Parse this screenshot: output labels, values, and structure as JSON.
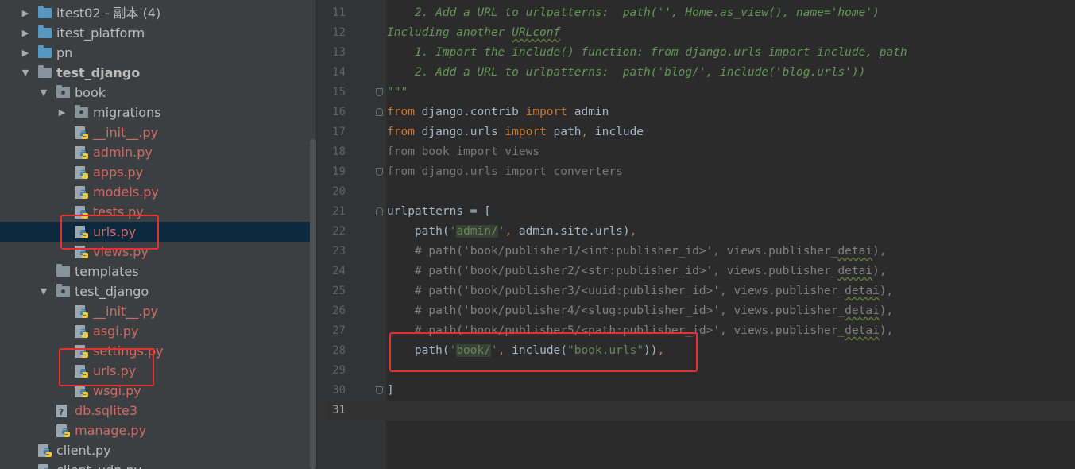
{
  "tree": {
    "rows": [
      {
        "id": "itest02",
        "label": "itest02 - 副本 (4)",
        "type": "folder",
        "expanded": false
      },
      {
        "id": "itest_platform",
        "label": "itest_platform",
        "type": "folder",
        "expanded": false
      },
      {
        "id": "pn",
        "label": "pn",
        "type": "folder",
        "expanded": false
      },
      {
        "id": "test_django_root",
        "label": "test_django",
        "type": "folder",
        "expanded": true
      },
      {
        "id": "book",
        "label": "book",
        "type": "package",
        "expanded": true
      },
      {
        "id": "migrations",
        "label": "migrations",
        "type": "package",
        "expanded": false
      },
      {
        "id": "book_init",
        "label": "__init__.py",
        "type": "python"
      },
      {
        "id": "book_admin",
        "label": "admin.py",
        "type": "python"
      },
      {
        "id": "book_apps",
        "label": "apps.py",
        "type": "python"
      },
      {
        "id": "book_models",
        "label": "models.py",
        "type": "python"
      },
      {
        "id": "book_tests",
        "label": "tests.py",
        "type": "python"
      },
      {
        "id": "book_urls",
        "label": "urls.py",
        "type": "python",
        "selected": true
      },
      {
        "id": "book_views",
        "label": "views.py",
        "type": "python"
      },
      {
        "id": "templates",
        "label": "templates",
        "type": "folder"
      },
      {
        "id": "test_django_pkg",
        "label": "test_django",
        "type": "package",
        "expanded": true
      },
      {
        "id": "td_init",
        "label": "__init__.py",
        "type": "python"
      },
      {
        "id": "td_asgi",
        "label": "asgi.py",
        "type": "python"
      },
      {
        "id": "td_settings",
        "label": "settings.py",
        "type": "python"
      },
      {
        "id": "td_urls",
        "label": "urls.py",
        "type": "python"
      },
      {
        "id": "td_wsgi",
        "label": "wsgi.py",
        "type": "python"
      },
      {
        "id": "db",
        "label": "db.sqlite3",
        "type": "db"
      },
      {
        "id": "manage",
        "label": "manage.py",
        "type": "python"
      },
      {
        "id": "client",
        "label": "client.py",
        "type": "python-plain"
      },
      {
        "id": "client_udp",
        "label": "client_udp.py",
        "type": "python-plain"
      }
    ]
  },
  "editor": {
    "current_line": "31",
    "lines": [
      {
        "no": "11",
        "tokens": [
          {
            "t": "    2. Add a URL to urlpatterns:  path('', Home.as_view(), name='home')",
            "c": "c-doc"
          }
        ]
      },
      {
        "no": "12",
        "tokens": [
          {
            "t": "Including another ",
            "c": "c-doc"
          },
          {
            "t": "URLconf",
            "c": "c-doc typo"
          }
        ]
      },
      {
        "no": "13",
        "tokens": [
          {
            "t": "    1. Import the include() function: from django.urls import include, path",
            "c": "c-doc"
          }
        ]
      },
      {
        "no": "14",
        "tokens": [
          {
            "t": "    2. Add a URL to urlpatterns:  path('blog/', include('blog.urls'))",
            "c": "c-doc"
          }
        ]
      },
      {
        "no": "15",
        "tokens": [
          {
            "t": "\"\"\"",
            "c": "c-doc"
          }
        ]
      },
      {
        "no": "16",
        "tokens": [
          {
            "t": "from",
            "c": "c-kw"
          },
          {
            "t": " django.contrib ",
            "c": "c-id"
          },
          {
            "t": "import",
            "c": "c-kw"
          },
          {
            "t": " admin",
            "c": "c-id"
          }
        ]
      },
      {
        "no": "17",
        "tokens": [
          {
            "t": "from",
            "c": "c-kw"
          },
          {
            "t": " django.urls ",
            "c": "c-id"
          },
          {
            "t": "import",
            "c": "c-kw"
          },
          {
            "t": " path",
            "c": "c-id"
          },
          {
            "t": ",",
            "c": "c-kw"
          },
          {
            "t": " include",
            "c": "c-id"
          }
        ]
      },
      {
        "no": "18",
        "tokens": [
          {
            "t": "from book import views",
            "c": "c-dim"
          }
        ]
      },
      {
        "no": "19",
        "tokens": [
          {
            "t": "from django.urls import converters",
            "c": "c-dim"
          }
        ]
      },
      {
        "no": "20",
        "tokens": []
      },
      {
        "no": "21",
        "tokens": [
          {
            "t": "urlpatterns = [",
            "c": "c-id"
          }
        ]
      },
      {
        "no": "22",
        "tokens": [
          {
            "t": "    path(",
            "c": "c-id"
          },
          {
            "t": "'",
            "c": "c-str"
          },
          {
            "t": "admin/",
            "c": "c-str-hl"
          },
          {
            "t": "'",
            "c": "c-str"
          },
          {
            "t": ",",
            "c": "c-kw"
          },
          {
            "t": " admin.site.urls)",
            "c": "c-id"
          },
          {
            "t": ",",
            "c": "c-kw"
          }
        ]
      },
      {
        "no": "23",
        "tokens": [
          {
            "t": "    # path('book/publisher1/<int:publisher_id>', views.publisher_",
            "c": "c-cmt"
          },
          {
            "t": "detai",
            "c": "c-cmt typo"
          },
          {
            "t": "),",
            "c": "c-cmt"
          }
        ]
      },
      {
        "no": "24",
        "tokens": [
          {
            "t": "    # path('book/publisher2/<str:publisher_id>', views.publisher_",
            "c": "c-cmt"
          },
          {
            "t": "detai",
            "c": "c-cmt typo"
          },
          {
            "t": "),",
            "c": "c-cmt"
          }
        ]
      },
      {
        "no": "25",
        "tokens": [
          {
            "t": "    # path('book/publisher3/<uuid:publisher_id>', views.publisher_",
            "c": "c-cmt"
          },
          {
            "t": "detai",
            "c": "c-cmt typo"
          },
          {
            "t": "),",
            "c": "c-cmt"
          }
        ]
      },
      {
        "no": "26",
        "tokens": [
          {
            "t": "    # path('book/publisher4/<slug:publisher_id>', views.publisher_",
            "c": "c-cmt"
          },
          {
            "t": "detai",
            "c": "c-cmt typo"
          },
          {
            "t": "),",
            "c": "c-cmt"
          }
        ]
      },
      {
        "no": "27",
        "tokens": [
          {
            "t": "    # path('book/publisher5/<path:publisher_id>', views.publisher_",
            "c": "c-cmt"
          },
          {
            "t": "detai",
            "c": "c-cmt typo"
          },
          {
            "t": "),",
            "c": "c-cmt"
          }
        ]
      },
      {
        "no": "28",
        "tokens": [
          {
            "t": "    path(",
            "c": "c-id"
          },
          {
            "t": "'",
            "c": "c-str"
          },
          {
            "t": "book/",
            "c": "c-str-hl"
          },
          {
            "t": "'",
            "c": "c-str"
          },
          {
            "t": ",",
            "c": "c-kw"
          },
          {
            "t": " include(",
            "c": "c-id"
          },
          {
            "t": "\"book.urls\"",
            "c": "c-str"
          },
          {
            "t": "))",
            "c": "c-id"
          },
          {
            "t": ",",
            "c": "c-kw"
          }
        ]
      },
      {
        "no": "29",
        "tokens": []
      },
      {
        "no": "30",
        "tokens": [
          {
            "t": "]",
            "c": "c-id"
          }
        ]
      },
      {
        "no": "31",
        "tokens": []
      }
    ]
  },
  "colors": {
    "annotation": "#e8302c",
    "tree_bg": "#3c3f41",
    "editor_bg": "#2b2b2b",
    "py_file": "#d06a62",
    "docstring": "#629755",
    "keyword": "#cc7832"
  }
}
